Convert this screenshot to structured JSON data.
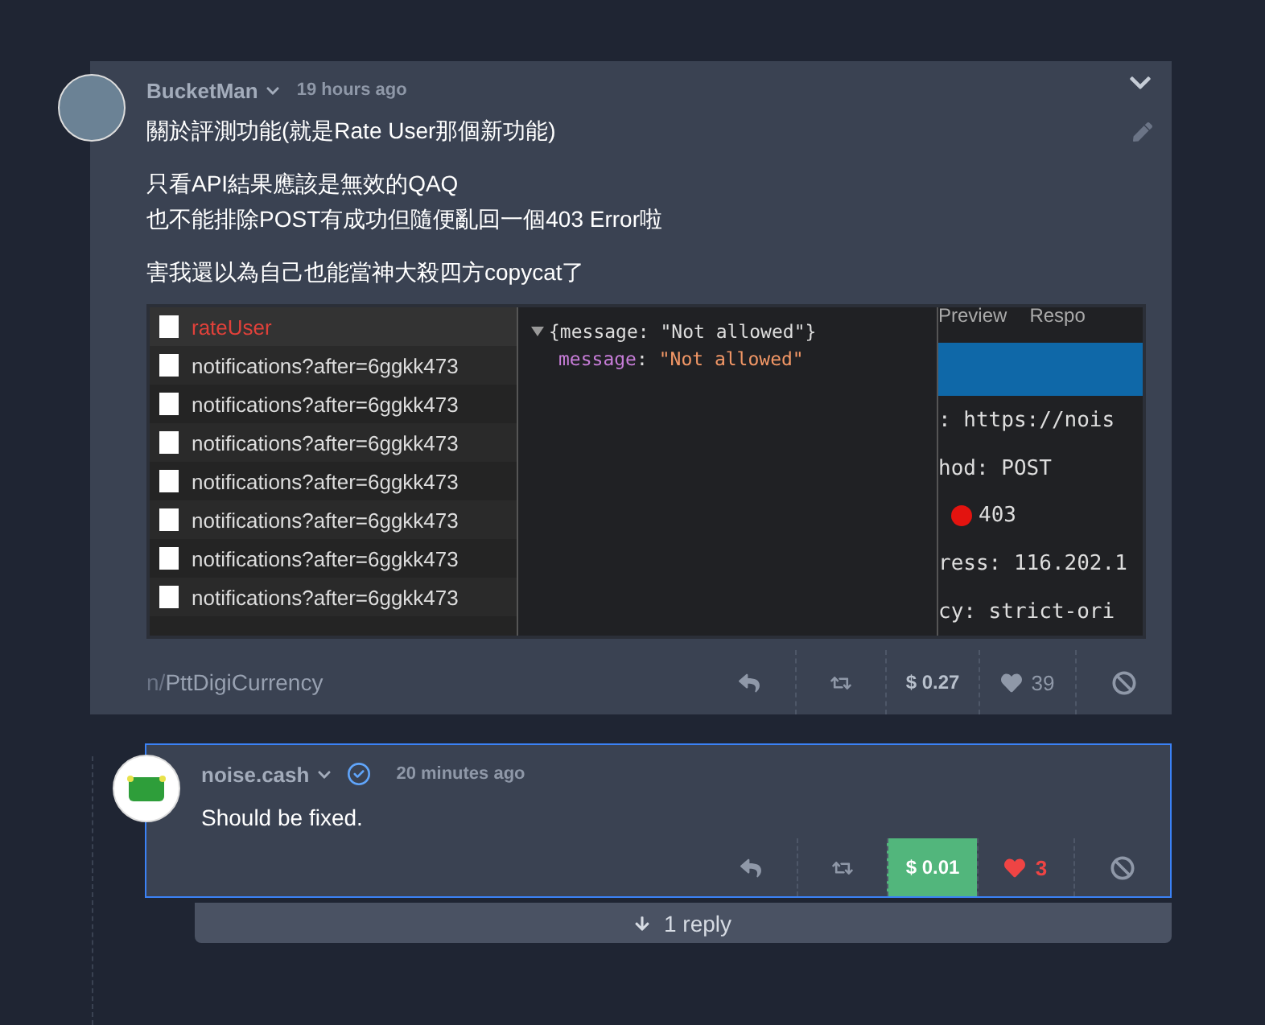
{
  "post": {
    "author": "BucketMan",
    "time": "19 hours ago",
    "collapsed": false,
    "paragraphs": [
      [
        "關於評測功能(就是Rate User那個新功能)"
      ],
      [
        "只看API結果應該是無效的QAQ",
        "也不能排除POST有成功但隨便亂回一個403 Error啦"
      ],
      [
        "害我還以為自己也能當神大殺四方copycat了"
      ]
    ],
    "screenshot": {
      "requests": [
        {
          "name": "rateUser",
          "kind": "error"
        },
        {
          "name": "notifications?after=6ggkk473",
          "kind": "ok"
        },
        {
          "name": "notifications?after=6ggkk473",
          "kind": "ok"
        },
        {
          "name": "notifications?after=6ggkk473",
          "kind": "ok"
        },
        {
          "name": "notifications?after=6ggkk473",
          "kind": "ok"
        },
        {
          "name": "notifications?after=6ggkk473",
          "kind": "ok"
        },
        {
          "name": "notifications?after=6ggkk473",
          "kind": "ok"
        },
        {
          "name": "notifications?after=6ggkk473",
          "kind": "ok"
        }
      ],
      "response": {
        "summary": "{message: \"Not allowed\"}",
        "key": "message",
        "colon": ":",
        "value": "\"Not allowed\""
      },
      "tabs": [
        "Preview",
        "Respo"
      ],
      "headers": [
        {
          "text": ": https://nois",
          "kind": "plain"
        },
        {
          "text": "hod: POST",
          "kind": "plain"
        },
        {
          "text": "403",
          "kind": "status"
        },
        {
          "text": "ress: 116.202.1",
          "kind": "plain"
        },
        {
          "text": "cy: strict-ori",
          "kind": "plain"
        }
      ]
    },
    "community_prefix": "n/",
    "community": "PttDigiCurrency",
    "tip": "$ 0.27",
    "likes": "39",
    "liked": false,
    "tipped": false
  },
  "reply": {
    "author": "noise.cash",
    "verified": true,
    "time": "20 minutes ago",
    "text": "Should be fixed.",
    "tip": "$ 0.01",
    "likes": "3",
    "liked": true,
    "tipped": true,
    "focused": true
  },
  "replies_button": "1 reply"
}
